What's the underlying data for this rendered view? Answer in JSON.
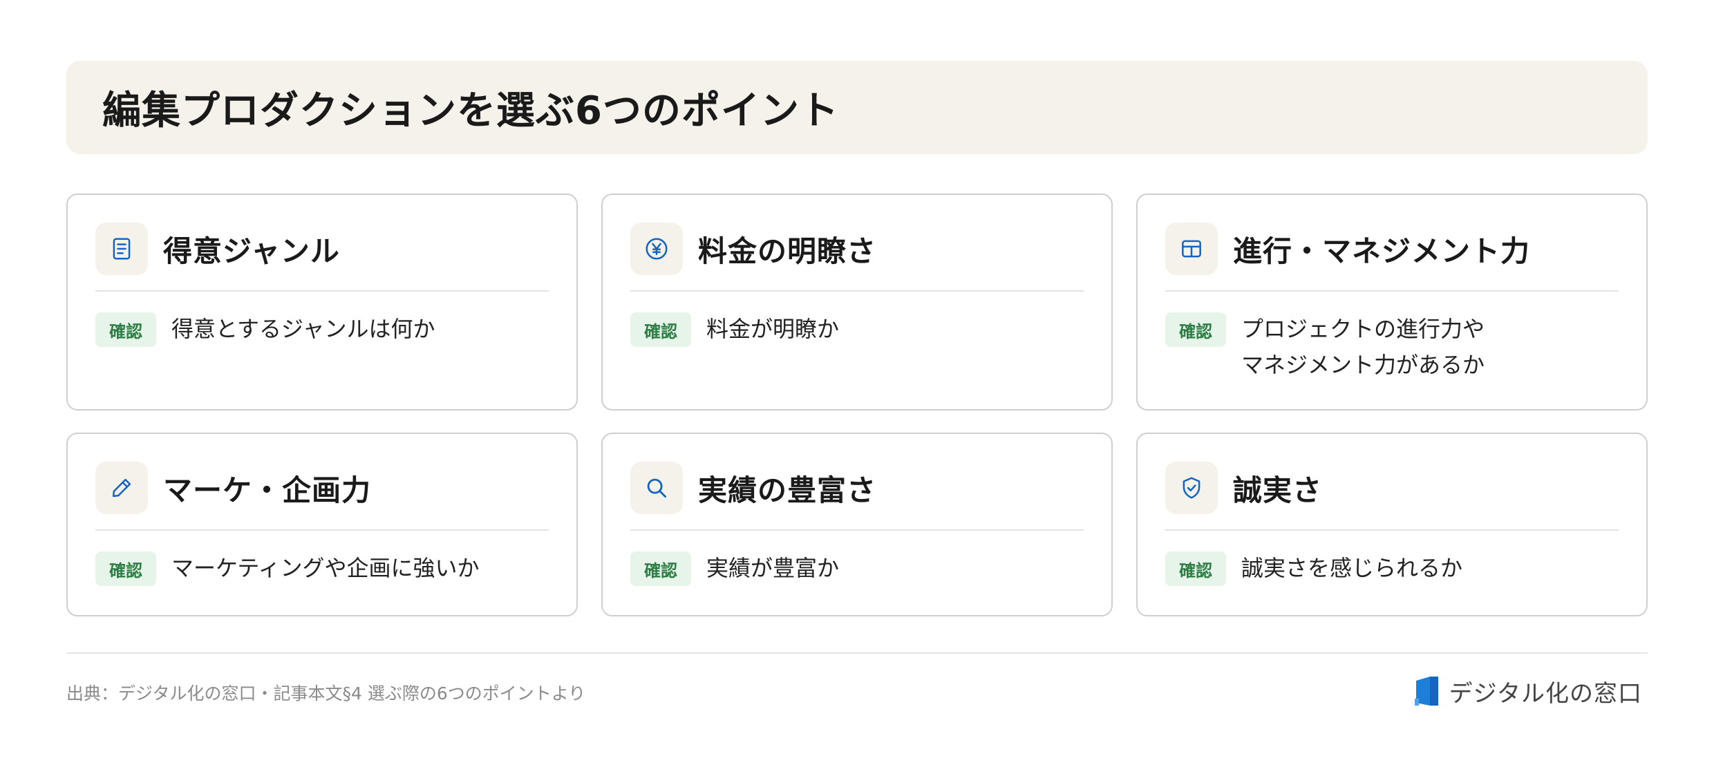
{
  "title": "編集プロダクションを選ぶ6つのポイント",
  "cards": [
    {
      "icon": "document-icon",
      "title": "得意ジャンル",
      "badge": "確認",
      "text": "得意とするジャンルは何か"
    },
    {
      "icon": "yen-icon",
      "title": "料金の明瞭さ",
      "badge": "確認",
      "text": "料金が明瞭か"
    },
    {
      "icon": "table-icon",
      "title": "進行・マネジメント力",
      "badge": "確認",
      "text": "プロジェクトの進行力や\nマネジメント力があるか"
    },
    {
      "icon": "pencil-icon",
      "title": "マーケ・企画力",
      "badge": "確認",
      "text": "マーケティングや企画に強いか"
    },
    {
      "icon": "search-icon",
      "title": "実績の豊富さ",
      "badge": "確認",
      "text": "実績が豊富か"
    },
    {
      "icon": "shield-check-icon",
      "title": "誠実さ",
      "badge": "確認",
      "text": "誠実さを感じられるか"
    }
  ],
  "footer": {
    "source": "出典：デジタル化の窓口・記事本文§4 選ぶ際の6つのポイントより",
    "brand": "デジタル化の窓口"
  },
  "colors": {
    "accent_blue": "#1565c0",
    "badge_green": "#2e7d45",
    "badge_bg": "#e7f4ea",
    "banner_bg": "#f5f2ec"
  }
}
